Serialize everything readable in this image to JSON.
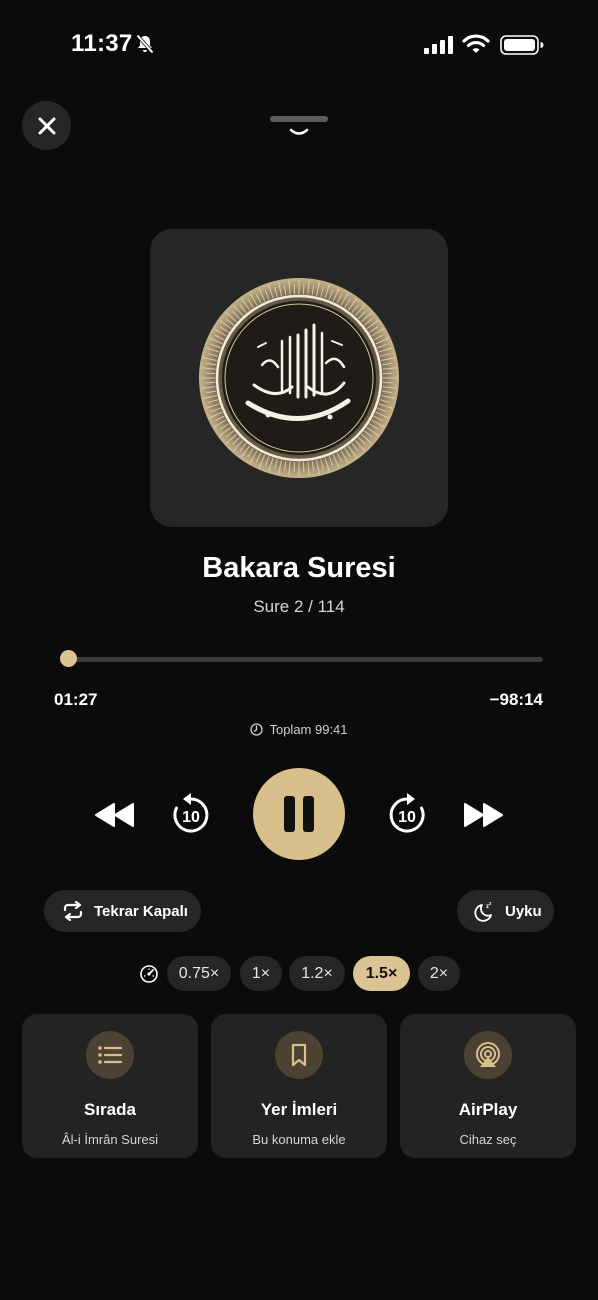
{
  "status_bar": {
    "time": "11:37"
  },
  "now_playing": {
    "title": "Bakara Suresi",
    "subtitle": "Sure 2 / 114",
    "artwork_icon": "bismillah-calligraphy-icon"
  },
  "progress": {
    "elapsed": "01:27",
    "remaining": "−98:14",
    "total_label": "Toplam 99:41",
    "fraction": 0.015
  },
  "controls": {
    "skip_back_seconds": "10",
    "skip_forward_seconds": "10",
    "state": "playing"
  },
  "repeat": {
    "label": "Tekrar Kapalı"
  },
  "sleep": {
    "label": "Uyku"
  },
  "speeds": {
    "options": [
      "0.75×",
      "1×",
      "1.2×",
      "1.5×",
      "2×"
    ],
    "selected": "1.5×"
  },
  "cards": [
    {
      "title": "Sırada",
      "subtitle": "Âl-i İmrân Suresi",
      "icon": "list-icon"
    },
    {
      "title": "Yer İmleri",
      "subtitle": "Bu konuma ekle",
      "icon": "bookmark-icon"
    },
    {
      "title": "AirPlay",
      "subtitle": "Cihaz seç",
      "icon": "airplay-icon"
    }
  ],
  "colors": {
    "accent": "#D9BF8C",
    "background": "#0B0B0B",
    "surface": "#262626"
  }
}
